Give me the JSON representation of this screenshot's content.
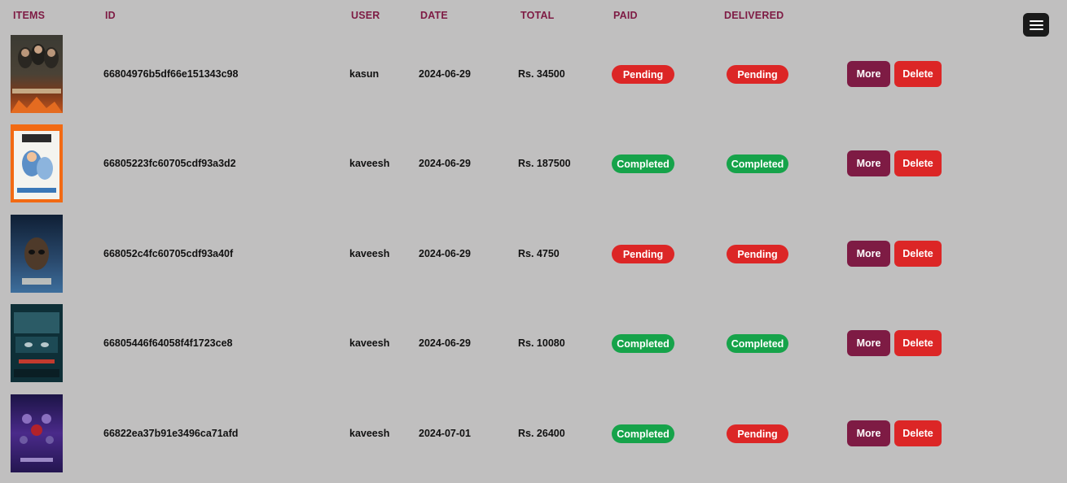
{
  "headers": {
    "items": "ITEMS",
    "id": "ID",
    "user": "USER",
    "date": "DATE",
    "total": "TOTAL",
    "paid": "PAID",
    "delivered": "DELIVERED"
  },
  "menu_icon": "hamburger-menu-icon",
  "actions": {
    "more_label": "More",
    "delete_label": "Delete"
  },
  "colors": {
    "header_text": "#7e1b44",
    "pending": "#dc2626",
    "completed": "#16a34a",
    "more_button": "#7e1b44",
    "delete_button": "#dc2626",
    "background": "#c0bfbf"
  },
  "orders": [
    {
      "poster": "supernatural-poster",
      "poster_text": "SUPERNATURAL",
      "id": "66804976b5df66e151343c98",
      "user": "kasun",
      "date": "2024-06-29",
      "total": "Rs. 34500",
      "paid": "Pending",
      "delivered": "Pending"
    },
    {
      "poster": "avatar-poster",
      "poster_text": "AVATAR",
      "id": "66805223fc60705cdf93a3d2",
      "user": "kaveesh",
      "date": "2024-06-29",
      "total": "Rs. 187500",
      "paid": "Completed",
      "delivered": "Completed"
    },
    {
      "poster": "alien-poster",
      "poster_text": "",
      "id": "668052c4fc60705cdf93a40f",
      "user": "kaveesh",
      "date": "2024-06-29",
      "total": "Rs. 4750",
      "paid": "Pending",
      "delivered": "Pending"
    },
    {
      "poster": "knock-knock-poster",
      "poster_text": "KNOCK KNOCK",
      "id": "66805446f64058f4f1723ce8",
      "user": "kaveesh",
      "date": "2024-06-29",
      "total": "Rs. 10080",
      "paid": "Completed",
      "delivered": "Completed"
    },
    {
      "poster": "avengers-endgame-poster",
      "poster_text": "",
      "id": "66822ea37b91e3496ca71afd",
      "user": "kaveesh",
      "date": "2024-07-01",
      "total": "Rs. 26400",
      "paid": "Completed",
      "delivered": "Pending"
    }
  ]
}
